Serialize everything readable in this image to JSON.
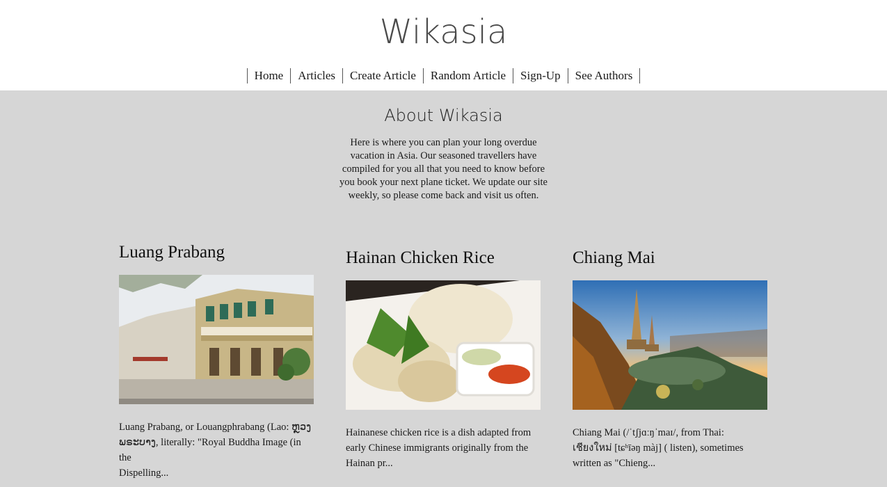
{
  "site": {
    "title": "Wikasia"
  },
  "nav": {
    "items": [
      {
        "label": "Home"
      },
      {
        "label": "Articles"
      },
      {
        "label": "Create Article"
      },
      {
        "label": "Random Article"
      },
      {
        "label": "Sign-Up"
      },
      {
        "label": "See Authors"
      }
    ]
  },
  "about": {
    "heading": "About Wikasia",
    "text": "Here is where you can plan your long overdue vacation in Asia. Our seasoned travellers have compiled for you all that you need to know before you book your next plane ticket. We update our site weekly, so please come back and visit us often."
  },
  "articles": [
    {
      "title": "Luang Prabang",
      "image": "street-with-colonial-buildings",
      "excerpt_lines": [
        "Luang Prabang, or Louangphrabang (Lao: ຫຼວງ",
        "ພຣະບາງ, literally: \"Royal Buddha Image (in the",
        "Dispelling..."
      ]
    },
    {
      "title": "Hainan Chicken Rice",
      "image": "chicken-rice-plate",
      "excerpt_lines": [
        "Hainanese chicken rice is a dish adapted from",
        "early Chinese immigrants originally from the",
        "Hainan pr..."
      ]
    },
    {
      "title": "Chiang Mai",
      "image": "pagodas-at-sunset",
      "excerpt_lines": [
        "Chiang Mai (/ˈtʃjɑːŋˈmaɪ/, from Thai:",
        "เชียงใหม่ [tɕʰīəŋ màj] ( listen), sometimes",
        "written as \"Chieng..."
      ]
    }
  ]
}
